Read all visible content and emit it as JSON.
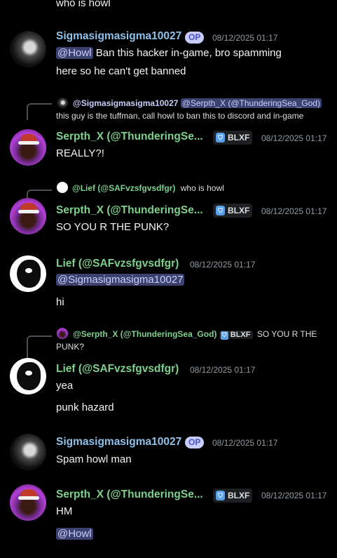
{
  "top_message": "who is howl",
  "messages": {
    "m1": {
      "author": "Sigmasigmasigma10027",
      "op": "OP",
      "time": "08/12/2025 01:17",
      "mention": "@Howl",
      "text_line1": " Ban this hacker in-game,  bro spamming",
      "text_line2": "here so he can't get banned"
    },
    "r1": {
      "reply_name": "@Sigmasigmasigma10027",
      "reply_mention": "@Serpth_X (@ThunderingSea_God)",
      "reply_body": "this guy is the tuffman, call howl to ban this to discord and in-game"
    },
    "m2": {
      "author": "Serpth_X (@ThunderingSe...",
      "tag": "BLXF",
      "time": "08/12/2025 01:17",
      "text": "REALLY?!"
    },
    "r2": {
      "reply_name": "@Lief (@SAFvzsfgvsdfgr)",
      "reply_body": "who is howl"
    },
    "m3": {
      "author": "Serpth_X (@ThunderingSe...",
      "tag": "BLXF",
      "time": "08/12/2025 01:17",
      "text": "SO YOU R THE PUNK?"
    },
    "m4": {
      "author": "Lief (@SAFvzsfgvsdfgr)",
      "time": "08/12/2025 01:17",
      "mention": "@Sigmasigmasigma10027",
      "text": "hi"
    },
    "r3": {
      "reply_name": "@Serpth_X (@ThunderingSea_God)",
      "reply_tag": "BLXF",
      "reply_body_line1": "SO YOU R THE",
      "reply_body_line2": "PUNK?"
    },
    "m5": {
      "author": "Lief (@SAFvzsfgvsdfgr)",
      "time": "08/12/2025 01:17",
      "text1": "yea",
      "text2": "punk hazard"
    },
    "m6": {
      "author": "Sigmasigmasigma10027",
      "op": "OP",
      "time": "08/12/2025 01:17",
      "text": "Spam howl man"
    },
    "m7": {
      "author": "Serpth_X (@ThunderingSe...",
      "tag": "BLXF",
      "time": "08/12/2025 01:17",
      "text": "HM",
      "mention": "@Howl"
    }
  },
  "icons": {
    "avatar_sigma": "avatar-dark-anime",
    "avatar_serpth": "avatar-purple-santa",
    "avatar_lief": "avatar-white-mask",
    "tag_icon": "shield-badge-icon"
  },
  "colors": {
    "background": "#000000",
    "name_blue": "#8fc1ea",
    "name_green": "#7ed08c",
    "mention_bg": "#3c4270",
    "op_badge": "#c9cdfb"
  }
}
